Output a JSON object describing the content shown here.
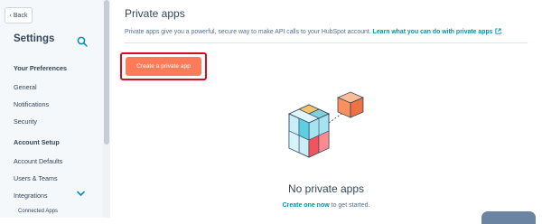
{
  "sidebar": {
    "back_label": "Back",
    "title": "Settings",
    "sections": [
      {
        "heading": "Your Preferences",
        "items": [
          "General",
          "Notifications",
          "Security"
        ]
      },
      {
        "heading": "Account Setup",
        "items": [
          "Account Defaults",
          "Users & Teams",
          "Integrations"
        ]
      }
    ],
    "integrations_sub": [
      "Connected Apps"
    ]
  },
  "main": {
    "title": "Private apps",
    "description": "Private apps give you a powerful, secure way to make API calls to your HubSpot account.",
    "learn_link": "Learn what you can do with private apps",
    "learn_suffix": ".",
    "create_button": "Create a private app",
    "empty_title": "No private apps",
    "empty_link": "Create one now",
    "empty_suffix": " to get started."
  },
  "colors": {
    "accent": "#ff7a59",
    "link": "#0091ae",
    "highlight": "#d70d1d"
  },
  "icons": [
    "chevron-left-icon",
    "search-icon",
    "chevron-down-icon",
    "external-link-icon",
    "cubes-illustration"
  ]
}
